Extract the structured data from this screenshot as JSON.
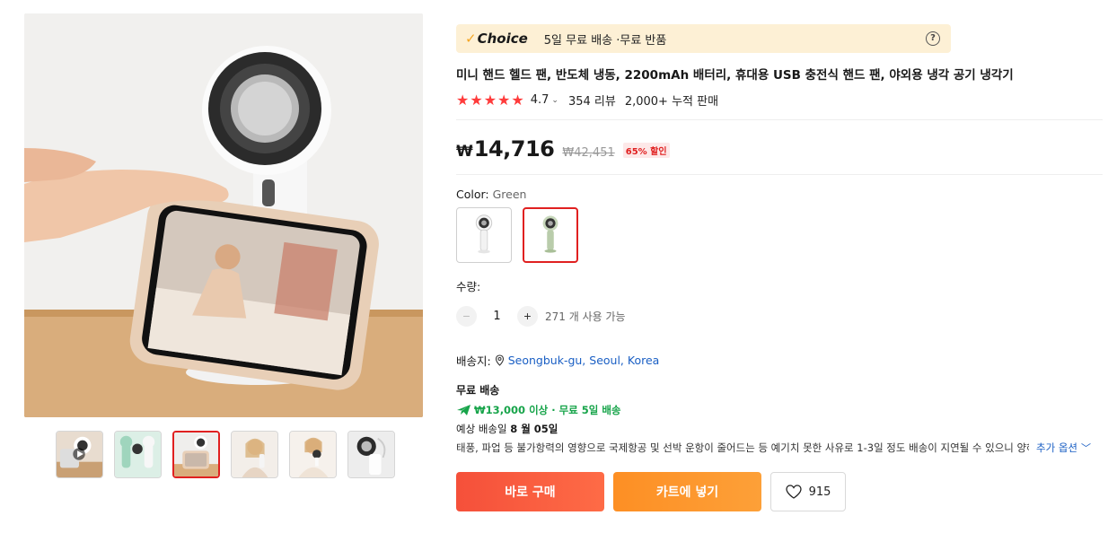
{
  "badge": {
    "logo_check": "✓",
    "logo_text": "Choice",
    "text": "5일 무료 배송 ·무료 반품",
    "help_icon": "question-circle-icon"
  },
  "product": {
    "title": "미니 핸드 헬드 팬, 반도체 냉동, 2200mAh 배터리, 휴대용 USB 충전식 핸드 팬, 야외용 냉각 공기 냉각기",
    "rating": "4.7",
    "rating_stars": 5,
    "reviews": "354 리뷰",
    "sold": "2,000+ 누적 판매"
  },
  "price": {
    "currency": "₩",
    "current": "14,716",
    "original": "₩42,451",
    "discount": "65% 할인"
  },
  "color": {
    "label": "Color: ",
    "selected": "Green",
    "options": [
      "White",
      "Green"
    ]
  },
  "quantity": {
    "label": "수량:",
    "value": "1",
    "minus": "−",
    "plus": "+",
    "available": "271 개 사용 가능"
  },
  "shipping": {
    "label": "배송지:",
    "location": "Seongbuk-gu, Seoul, Korea",
    "free_title": "무료 배송",
    "promo": "₩13,000 이상 · 무료 5일 배송",
    "eta_prefix": "예상 배송일 ",
    "eta_date": "8 월 05일",
    "notice": "태풍, 파업 등 불가항력의 영향으로 국제항공 및 선박 운항이 줄어드는 등 예기치 못한 사유로 1-3일 정도 배송이 지연될 수 있으니 양해 부탁드립니다.",
    "more_options": "추가 옵션",
    "colors": {
      "promo": "#17a44a",
      "link": "#1a5fc4"
    }
  },
  "actions": {
    "buy_now": "바로 구매",
    "add_to_cart": "카트에 넣기",
    "wishlist_count": "915"
  },
  "colors": {
    "accent_red": "#e02020",
    "buy_button": "#f5503a",
    "cart_button": "#fd8f24",
    "star": "#ff3b3b"
  }
}
